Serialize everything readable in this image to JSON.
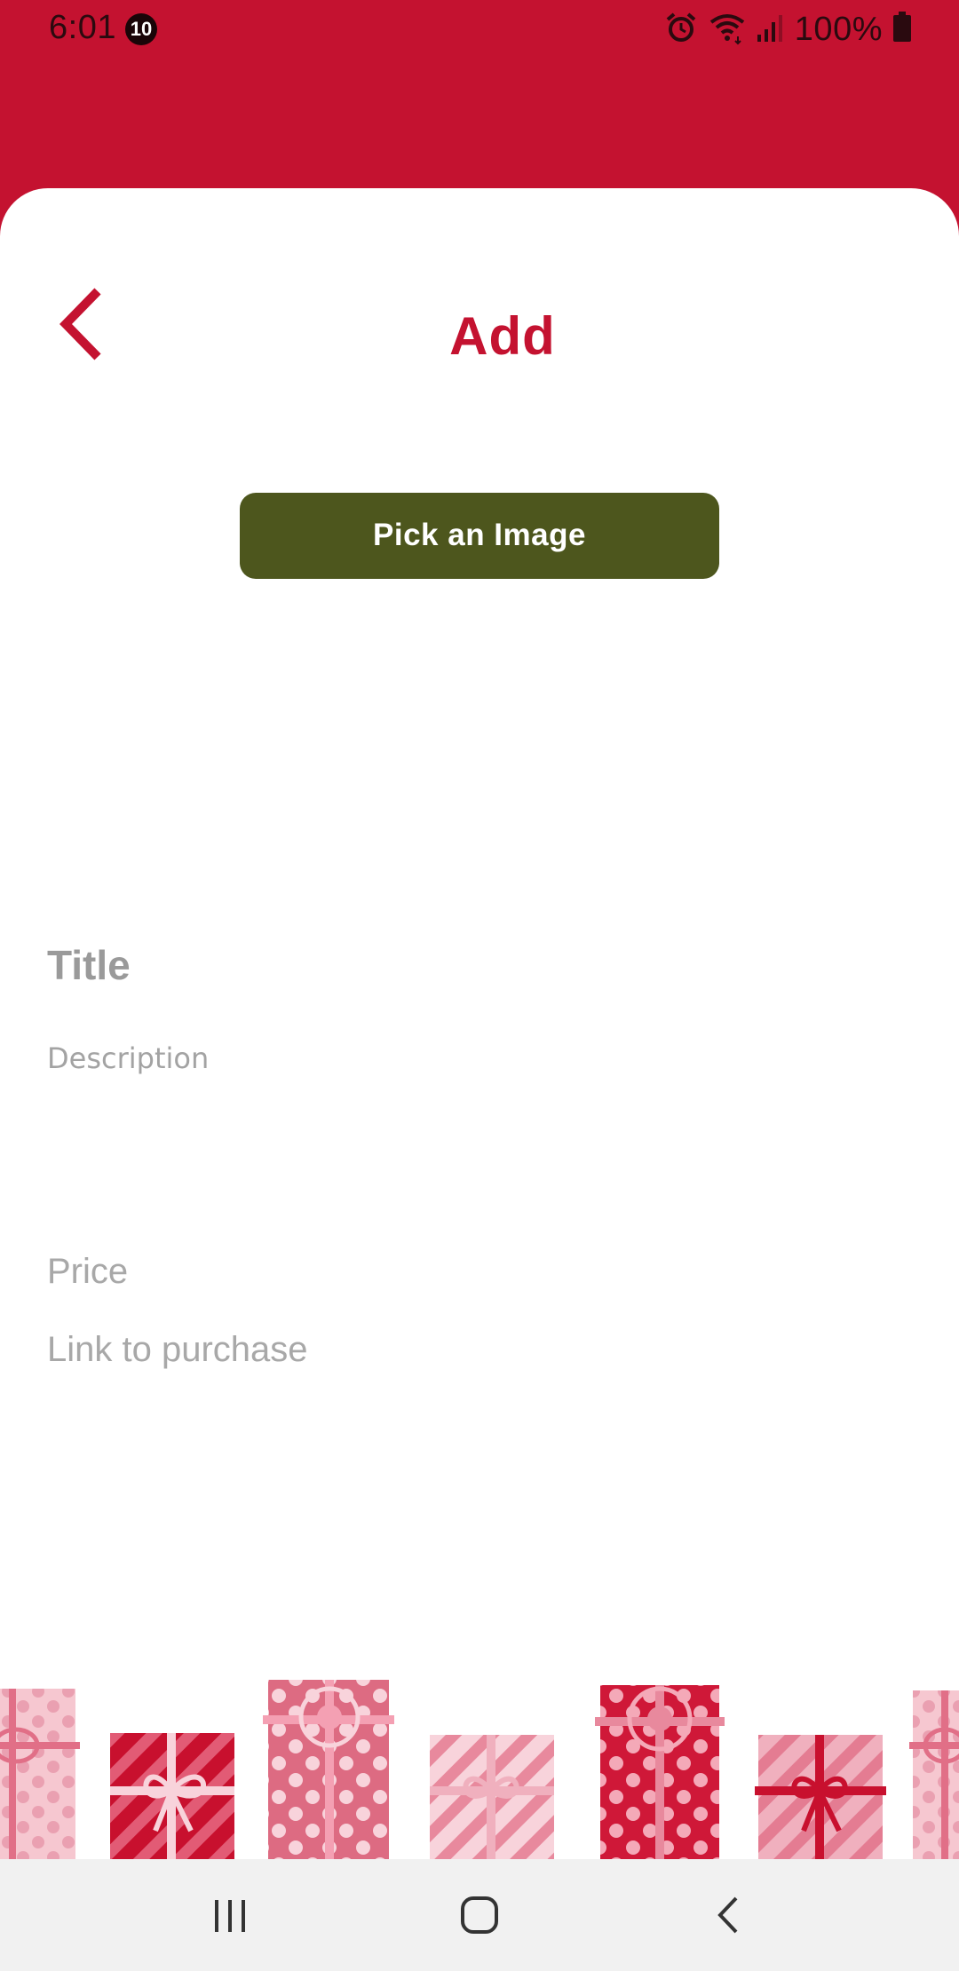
{
  "status_bar": {
    "time": "6:01",
    "notification_count": "10",
    "battery": "100%",
    "icons": [
      "alarm-icon",
      "wifi-icon",
      "signal-icon",
      "battery-icon"
    ]
  },
  "header": {
    "back_icon": "chevron-left-icon",
    "title": "Add"
  },
  "actions": {
    "pick_image_label": "Pick an Image"
  },
  "form": {
    "title_placeholder": "Title",
    "description_placeholder": "Description",
    "price_placeholder": "Price",
    "link_placeholder": "Link to purchase"
  },
  "decoration": {
    "name": "gift-boxes-illustration"
  },
  "nav_bar": {
    "icons": [
      "recent-apps-icon",
      "home-icon",
      "back-icon"
    ]
  },
  "colors": {
    "accent": "#c41230",
    "button": "#4d561d",
    "placeholder": "#9e9e9e",
    "nav_bar": "#f1f1f1"
  }
}
